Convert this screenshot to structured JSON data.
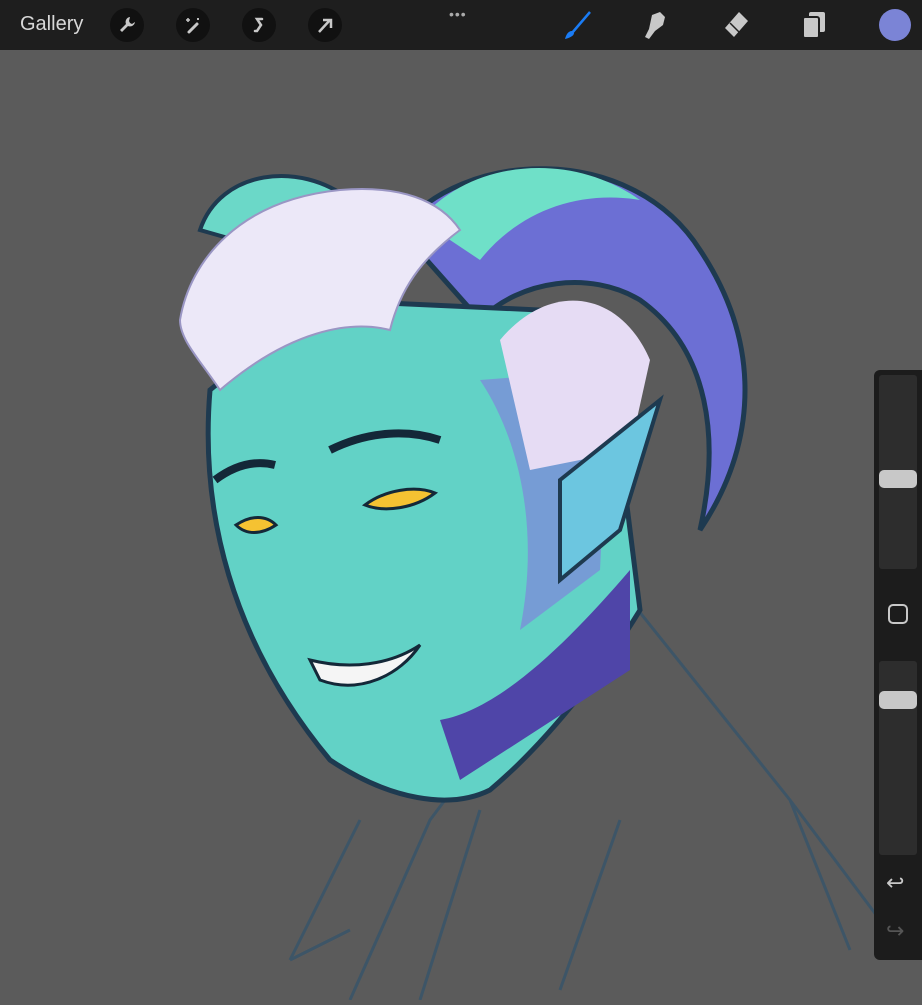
{
  "toolbar": {
    "gallery_label": "Gallery",
    "left_tools": [
      "wrench-icon",
      "magic-wand-icon",
      "selection-icon",
      "transform-arrow-icon"
    ],
    "more_label": "•••",
    "right_tools": [
      "brush-icon",
      "smudge-icon",
      "eraser-icon",
      "layers-icon"
    ],
    "active_tool": "brush",
    "current_color": "#7b84d6",
    "accent": "#1a7cf5"
  },
  "sidebar": {
    "brush_size": 0.46,
    "opacity": 0.83
  }
}
